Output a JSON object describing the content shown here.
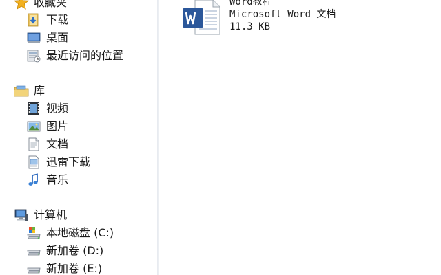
{
  "navigation": {
    "favorites": {
      "label": "收藏夹",
      "items": [
        {
          "label": "下载",
          "icon": "downloads-folder-icon"
        },
        {
          "label": "桌面",
          "icon": "desktop-icon"
        },
        {
          "label": "最近访问的位置",
          "icon": "recent-places-icon"
        }
      ]
    },
    "libraries": {
      "label": "库",
      "items": [
        {
          "label": "视频",
          "icon": "video-library-icon"
        },
        {
          "label": "图片",
          "icon": "pictures-library-icon"
        },
        {
          "label": "文档",
          "icon": "documents-library-icon"
        },
        {
          "label": "迅雷下载",
          "icon": "xunlei-download-icon"
        },
        {
          "label": "音乐",
          "icon": "music-library-icon"
        }
      ]
    },
    "computer": {
      "label": "计算机",
      "items": [
        {
          "label": "本地磁盘 (C:)",
          "icon": "system-drive-icon"
        },
        {
          "label": "新加卷 (D:)",
          "icon": "drive-icon"
        },
        {
          "label": "新加卷 (E:)",
          "icon": "drive-icon"
        }
      ]
    }
  },
  "content": {
    "files": [
      {
        "name": "Word教程",
        "type": "Microsoft Word 文档",
        "size": "11.3 KB",
        "icon": "word-document-icon",
        "icon_color": "#2b579a"
      }
    ]
  },
  "colors": {
    "accent": "#2b579a",
    "star": "#f2b01e",
    "folder": "#e8c262"
  }
}
